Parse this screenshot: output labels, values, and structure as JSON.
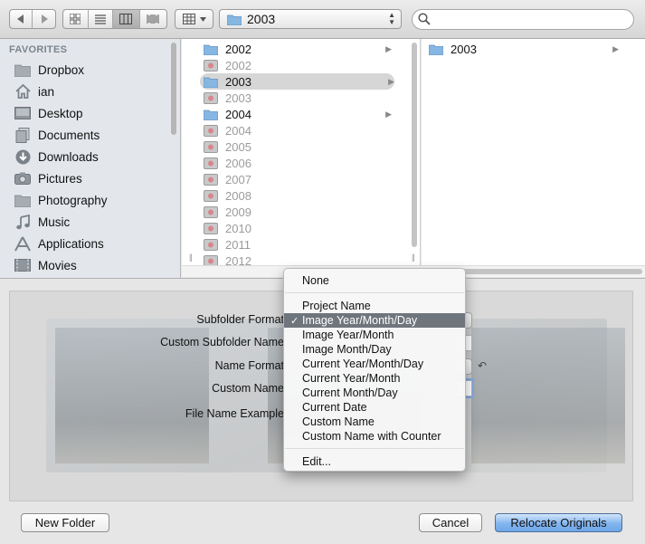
{
  "toolbar": {
    "path_folder": "2003",
    "search_placeholder": ""
  },
  "sidebar": {
    "heading": "FAVORITES",
    "items": [
      {
        "label": "Dropbox",
        "icon": "dropbox-folder-icon"
      },
      {
        "label": "ian",
        "icon": "home-icon"
      },
      {
        "label": "Desktop",
        "icon": "desktop-icon"
      },
      {
        "label": "Documents",
        "icon": "documents-icon"
      },
      {
        "label": "Downloads",
        "icon": "downloads-icon"
      },
      {
        "label": "Pictures",
        "icon": "camera-icon"
      },
      {
        "label": "Photography",
        "icon": "folder-icon"
      },
      {
        "label": "Music",
        "icon": "music-note-icon"
      },
      {
        "label": "Applications",
        "icon": "applications-icon"
      },
      {
        "label": "Movies",
        "icon": "movies-icon"
      }
    ]
  },
  "column1": {
    "rows": [
      {
        "label": "2002",
        "kind": "folder",
        "arrow": true
      },
      {
        "label": "2002",
        "kind": "library",
        "arrow": false
      },
      {
        "label": "2003",
        "kind": "folder",
        "arrow": true,
        "selected": true
      },
      {
        "label": "2003",
        "kind": "library",
        "arrow": false
      },
      {
        "label": "2004",
        "kind": "folder",
        "arrow": true
      },
      {
        "label": "2004",
        "kind": "library",
        "arrow": false
      },
      {
        "label": "2005",
        "kind": "library",
        "arrow": false
      },
      {
        "label": "2006",
        "kind": "library",
        "arrow": false
      },
      {
        "label": "2007",
        "kind": "library",
        "arrow": false
      },
      {
        "label": "2008",
        "kind": "library",
        "arrow": false
      },
      {
        "label": "2009",
        "kind": "library",
        "arrow": false
      },
      {
        "label": "2010",
        "kind": "library",
        "arrow": false
      },
      {
        "label": "2011",
        "kind": "library",
        "arrow": false
      },
      {
        "label": "2012",
        "kind": "library",
        "arrow": false
      }
    ]
  },
  "column2": {
    "rows": [
      {
        "label": "2003",
        "kind": "folder",
        "arrow": true
      }
    ]
  },
  "options": {
    "subfolder_format_label": "Subfolder Format",
    "custom_subfolder_name_label": "Custom Subfolder Name",
    "name_format_label": "Name Format",
    "custom_name_label": "Custom Name",
    "file_name_example_label": "File Name Example"
  },
  "menu": {
    "items": [
      {
        "label": "None"
      },
      {
        "separator": true
      },
      {
        "label": "Project Name"
      },
      {
        "label": "Image Year/Month/Day",
        "checked": true
      },
      {
        "label": "Image Year/Month"
      },
      {
        "label": "Image Month/Day"
      },
      {
        "label": "Current Year/Month/Day"
      },
      {
        "label": "Current Year/Month"
      },
      {
        "label": "Current Month/Day"
      },
      {
        "label": "Current Date"
      },
      {
        "label": "Custom Name"
      },
      {
        "label": "Custom Name with Counter"
      },
      {
        "separator": true
      },
      {
        "label": "Edit..."
      }
    ],
    "check_glyph": "✓"
  },
  "buttons": {
    "new_folder": "New Folder",
    "cancel": "Cancel",
    "relocate": "Relocate Originals"
  },
  "colors": {
    "accent": "#7fa9e3",
    "menu_highlight": "#6f757c",
    "folder_blue": "#7fb2e0"
  }
}
